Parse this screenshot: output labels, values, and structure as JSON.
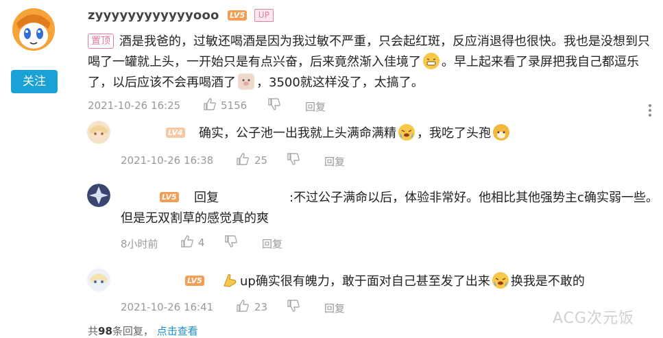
{
  "main_comment": {
    "username": "zyyyyyyyyyyyyooo",
    "level": "LV5",
    "up_badge": "UP",
    "pin_label": "置顶",
    "text_1": "酒是我爸的，过敏还喝酒是因为我过敏不严重，只会起红斑，反应消退得也很快。我也是没想到只喝了一罐就上头，一开始只是有点兴奋，后来竟然渐入佳境了",
    "text_2": "。早上起来看了录屏把我自己都逗乐了，以后应该不会再喝酒了",
    "text_3": "，3500就这样没了，太搞了。",
    "timestamp": "2021-10-26 16:25",
    "likes": "5156",
    "reply_label": "回复",
    "follow_label": "关注"
  },
  "replies": [
    {
      "level": "LV4",
      "text_1": "确实，公子池一出我就上头满命满精",
      "text_2": "，我吃了头孢",
      "timestamp": "2021-10-26 16:38",
      "likes": "25",
      "reply_label": "回复"
    },
    {
      "level": "LV5",
      "reply_prefix": "回复",
      "text": ":不过公子满命以后，体验非常好。他相比其他强势主c确实弱一些。但是无双割草的感觉真的爽",
      "timestamp": "8小时前",
      "likes": "4",
      "reply_label": "回复"
    },
    {
      "level": "LV5",
      "text_1": "up确实很有魄力，敢于面对自己甚至发了出来",
      "text_2": "换我是不敢的",
      "timestamp": "2021-10-26 16:41",
      "likes": "23",
      "reply_label": "回复"
    }
  ],
  "footer": {
    "total_prefix": "共",
    "total_count": "98",
    "total_suffix": "条回复，",
    "view_link": "点击查看"
  },
  "watermark": "ACG次元饭",
  "colors": {
    "accent": "#1aa2d6",
    "pin": "#e27aa0",
    "level5": "#f49e55",
    "level4": "#f8c8a0",
    "meta": "#999999",
    "link": "#1a8fd6"
  },
  "icons": [
    "thumb-up-icon",
    "thumb-down-icon",
    "more-vertical-icon",
    "grin-emoji",
    "pig-emoji",
    "crying-emoji",
    "dog-emoji",
    "ok-hand-emoji"
  ]
}
